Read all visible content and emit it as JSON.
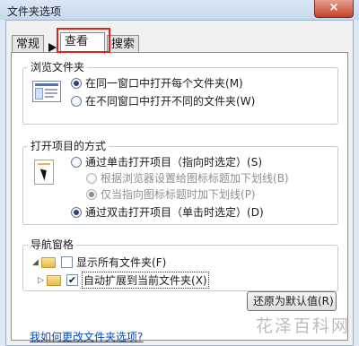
{
  "window": {
    "title": "文件夹选项",
    "close_label": "×"
  },
  "tabs": [
    {
      "label": "常规"
    },
    {
      "label": "查看"
    },
    {
      "label": "搜索"
    }
  ],
  "browse_group": {
    "title": "浏览文件夹",
    "options": [
      {
        "label": "在同一窗口中打开每个文件夹",
        "hotkey": "(M)",
        "checked": true
      },
      {
        "label": "在不同窗口中打开不同的文件夹",
        "hotkey": "(W)",
        "checked": false
      }
    ]
  },
  "open_group": {
    "title": "打开项目的方式",
    "single_click": {
      "label": "通过单击打开项目（指向时选定）",
      "hotkey": "(S)"
    },
    "underline_browser": {
      "label": "根据浏览器设置给图标标题加下划线",
      "hotkey": "(B)"
    },
    "underline_point": {
      "label": "仅当指向图标标题时加下划线",
      "hotkey": "(P)"
    },
    "double_click": {
      "label": "通过双击打开项目（单击时选定）",
      "hotkey": "(D)"
    }
  },
  "nav_group": {
    "title": "导航窗格",
    "show_all": {
      "label": "显示所有文件夹",
      "hotkey": "(F)",
      "checked": false
    },
    "auto_expand": {
      "label": "自动扩展到当前文件夹",
      "hotkey": "(X)",
      "checked": true
    }
  },
  "buttons": {
    "restore_defaults": "还原为默认值(R)"
  },
  "help_link": "我如何更改文件夹选项?",
  "watermark": "花泽百科网"
}
